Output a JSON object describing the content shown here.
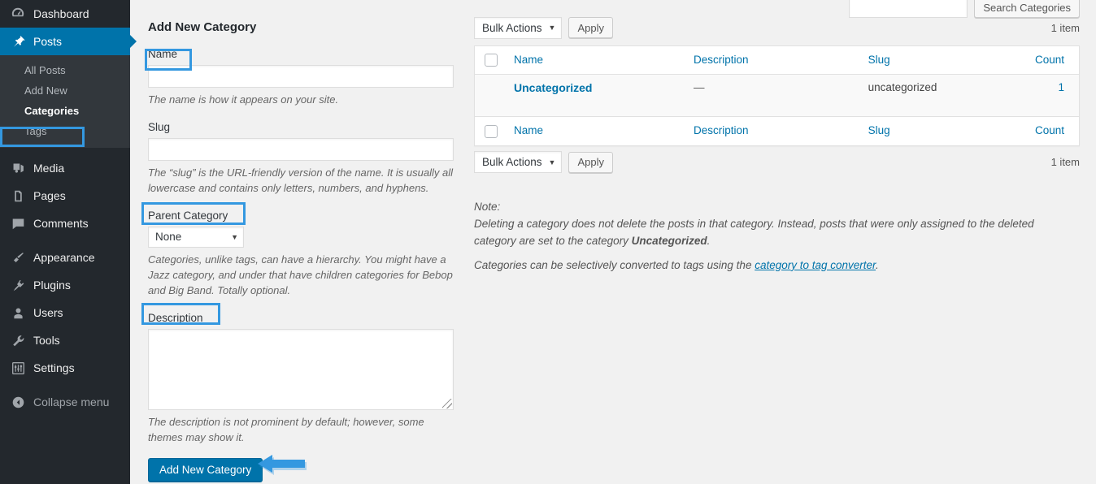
{
  "sidebar": {
    "items": [
      {
        "label": "Dashboard",
        "icon": "dashboard-icon",
        "current": false
      },
      {
        "label": "Posts",
        "icon": "pin-icon",
        "current": true
      },
      {
        "label": "Media",
        "icon": "media-icon",
        "current": false
      },
      {
        "label": "Pages",
        "icon": "pages-icon",
        "current": false
      },
      {
        "label": "Comments",
        "icon": "comment-icon",
        "current": false
      },
      {
        "label": "Appearance",
        "icon": "brush-icon",
        "current": false
      },
      {
        "label": "Plugins",
        "icon": "plug-icon",
        "current": false
      },
      {
        "label": "Users",
        "icon": "user-icon",
        "current": false
      },
      {
        "label": "Tools",
        "icon": "wrench-icon",
        "current": false
      },
      {
        "label": "Settings",
        "icon": "sliders-icon",
        "current": false
      }
    ],
    "submenu": [
      {
        "label": "All Posts"
      },
      {
        "label": "Add New"
      },
      {
        "label": "Categories"
      },
      {
        "label": "Tags"
      }
    ],
    "collapse_label": "Collapse menu",
    "collapse_icon": "collapse-arrow-icon"
  },
  "form": {
    "title": "Add New Category",
    "name_label": "Name",
    "name_value": "",
    "name_help": "The name is how it appears on your site.",
    "slug_label": "Slug",
    "slug_value": "",
    "slug_help": "The “slug” is the URL-friendly version of the name. It is usually all lowercase and contains only letters, numbers, and hyphens.",
    "parent_label": "Parent Category",
    "parent_value": "None",
    "parent_help": "Categories, unlike tags, can have a hierarchy. You might have a Jazz category, and under that have children categories for Bebop and Big Band. Totally optional.",
    "description_label": "Description",
    "description_value": "",
    "description_help": "The description is not prominent by default; however, some themes may show it.",
    "submit_label": "Add New Category"
  },
  "search": {
    "value": "",
    "button_label": "Search Categories"
  },
  "tablenav_top": {
    "bulk_label": "Bulk Actions",
    "apply_label": "Apply",
    "item_count": "1 item"
  },
  "tablenav_bottom": {
    "bulk_label": "Bulk Actions",
    "apply_label": "Apply",
    "item_count": "1 item"
  },
  "table": {
    "columns": {
      "name": "Name",
      "description": "Description",
      "slug": "Slug",
      "count": "Count"
    },
    "rows": [
      {
        "name": "Uncategorized",
        "description": "—",
        "slug": "uncategorized",
        "count": "1"
      }
    ]
  },
  "note": {
    "heading": "Note:",
    "line1_a": "Deleting a category does not delete the posts in that category. Instead, posts that were only assigned to the deleted category are set to the category ",
    "line1_b": "Uncategorized",
    "line1_c": ".",
    "line2_a": "Categories can be selectively converted to tags using the ",
    "line2_link": "category to tag converter",
    "line2_b": "."
  },
  "annotations": {
    "accent_color": "#3498e0",
    "boxes": [
      "name-label",
      "parent-category-label",
      "description-label",
      "sidebar-categories"
    ],
    "arrow": "add-new-category-arrow"
  },
  "colors": {
    "sidebar_bg": "#23282d",
    "submenu_bg": "#32373c",
    "current_menu": "#0073aa",
    "link": "#0073aa",
    "page_bg": "#f1f1f1"
  }
}
